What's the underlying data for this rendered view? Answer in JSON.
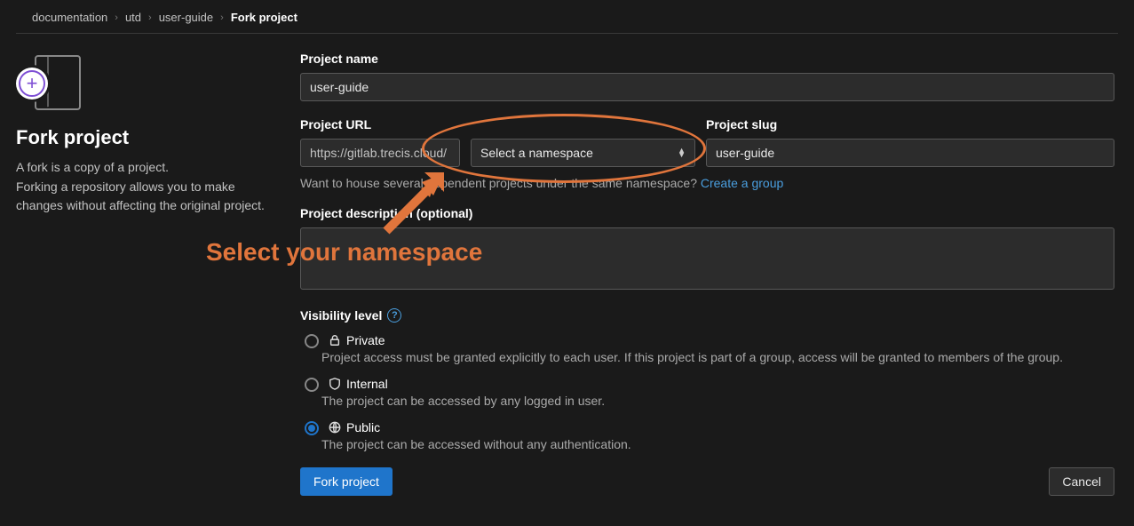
{
  "breadcrumb": {
    "items": [
      "documentation",
      "utd",
      "user-guide"
    ],
    "current": "Fork project"
  },
  "sidebar": {
    "title": "Fork project",
    "desc": "A fork is a copy of a project.\nForking a repository allows you to make changes without affecting the original project."
  },
  "form": {
    "project_name_label": "Project name",
    "project_name_value": "user-guide",
    "project_url_label": "Project URL",
    "project_url_value": "https://gitlab.trecis.cloud/",
    "namespace_placeholder": "Select a namespace",
    "project_slug_label": "Project slug",
    "project_slug_value": "user-guide",
    "namespace_hint_text": "Want to house several dependent projects under the same namespace? ",
    "namespace_hint_link": "Create a group",
    "description_label": "Project description (optional)",
    "description_value": "",
    "visibility_label": "Visibility level",
    "visibility": {
      "private": {
        "label": "Private",
        "desc": "Project access must be granted explicitly to each user. If this project is part of a group, access will be granted to members of the group."
      },
      "internal": {
        "label": "Internal",
        "desc": "The project can be accessed by any logged in user."
      },
      "public": {
        "label": "Public",
        "desc": "The project can be accessed without any authentication."
      },
      "selected": "public"
    },
    "submit_label": "Fork project",
    "cancel_label": "Cancel"
  },
  "annotation": {
    "text": "Select your namespace"
  }
}
